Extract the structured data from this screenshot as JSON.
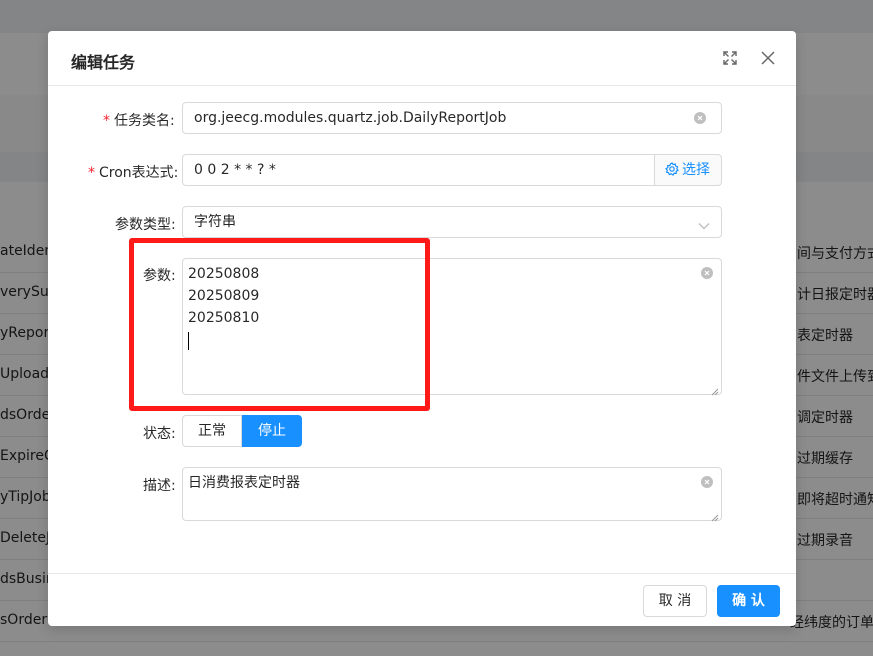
{
  "background": {
    "left_cells": [
      "ateIden",
      "verySuc",
      "yReport",
      "UploadJo",
      "dsOrder.",
      "ExpireCa",
      "yTipJob",
      "DeleteJo",
      "dsBusin",
      "sOrderLo"
    ],
    "right_cells": [
      "间与支付方式",
      "计日报定时器",
      "表定时器",
      "件文件上传到FI",
      "调定时器",
      "过期缓存",
      "即将超时通知",
      "过期录音",
      "",
      ""
    ],
    "right_header": "",
    "bottom_right_text": "经纬度的订单"
  },
  "modal": {
    "title": "编辑任务",
    "form": {
      "job_class": {
        "label": "任务类名:",
        "value": "org.jeecg.modules.quartz.job.DailyReportJob"
      },
      "cron": {
        "label": "Cron表达式:",
        "value": "0 0 2 * * ? *",
        "select_label": "选择"
      },
      "param_type": {
        "label": "参数类型:",
        "value": "字符串"
      },
      "params": {
        "label": "参数:",
        "lines": [
          "20250808",
          "20250809",
          "20250810"
        ]
      },
      "status": {
        "label": "状态:",
        "options": [
          "正常",
          "停止"
        ],
        "selected": "停止"
      },
      "description": {
        "label": "描述:",
        "value": "日消费报表定时器"
      }
    },
    "footer": {
      "cancel_label": "取 消",
      "ok_label": "确 认"
    }
  },
  "colors": {
    "primary": "#1890ff",
    "required": "#f5222d",
    "highlight": "#ff1a1a"
  },
  "icons": [
    "expand-icon",
    "close-icon",
    "clear-icon",
    "gear-icon",
    "chevron-down-icon"
  ]
}
